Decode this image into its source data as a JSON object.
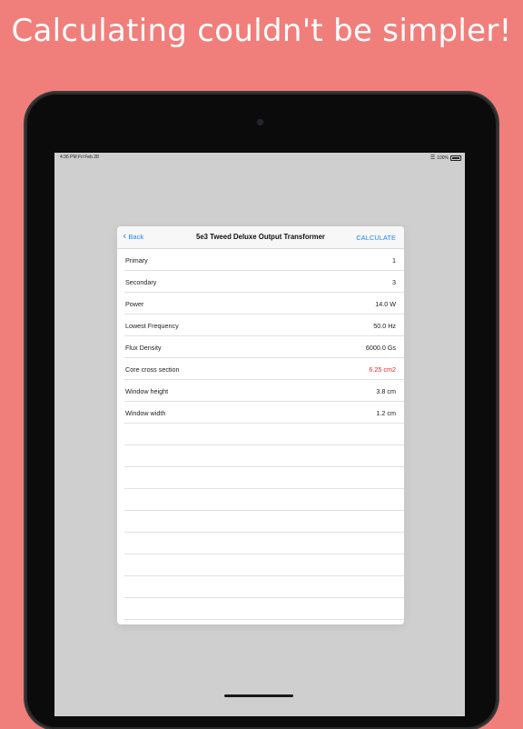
{
  "headline": "Calculating couldn't be simpler!",
  "status_bar": {
    "time_date": "4:36 PM   Fri Feb 28",
    "battery": "100%"
  },
  "navigation": {
    "back_label": "Back",
    "title": "5e3 Tweed Deluxe Output Transformer",
    "action_label": "CALCULATE"
  },
  "rows": [
    {
      "label": "Primary",
      "value": "1",
      "highlight": false
    },
    {
      "label": "Secondary",
      "value": "3",
      "highlight": false
    },
    {
      "label": "Power",
      "value": "14.0 W",
      "highlight": false
    },
    {
      "label": "Lowest Frequency",
      "value": "50.0 Hz",
      "highlight": false
    },
    {
      "label": "Flux Density",
      "value": "6000.0 Gs",
      "highlight": false
    },
    {
      "label": "Core cross section",
      "value": "6.25 cm2",
      "highlight": true
    },
    {
      "label": "Window height",
      "value": "3.8 cm",
      "highlight": false
    },
    {
      "label": "Window width",
      "value": "1.2 cm",
      "highlight": false
    }
  ],
  "colors": {
    "background": "#f07f7b",
    "accent": "#1a84ff",
    "highlight": "#e22b2b"
  },
  "icons": {
    "back": "chevron-left-icon",
    "wifi": "wifi-icon",
    "battery": "battery-icon"
  }
}
